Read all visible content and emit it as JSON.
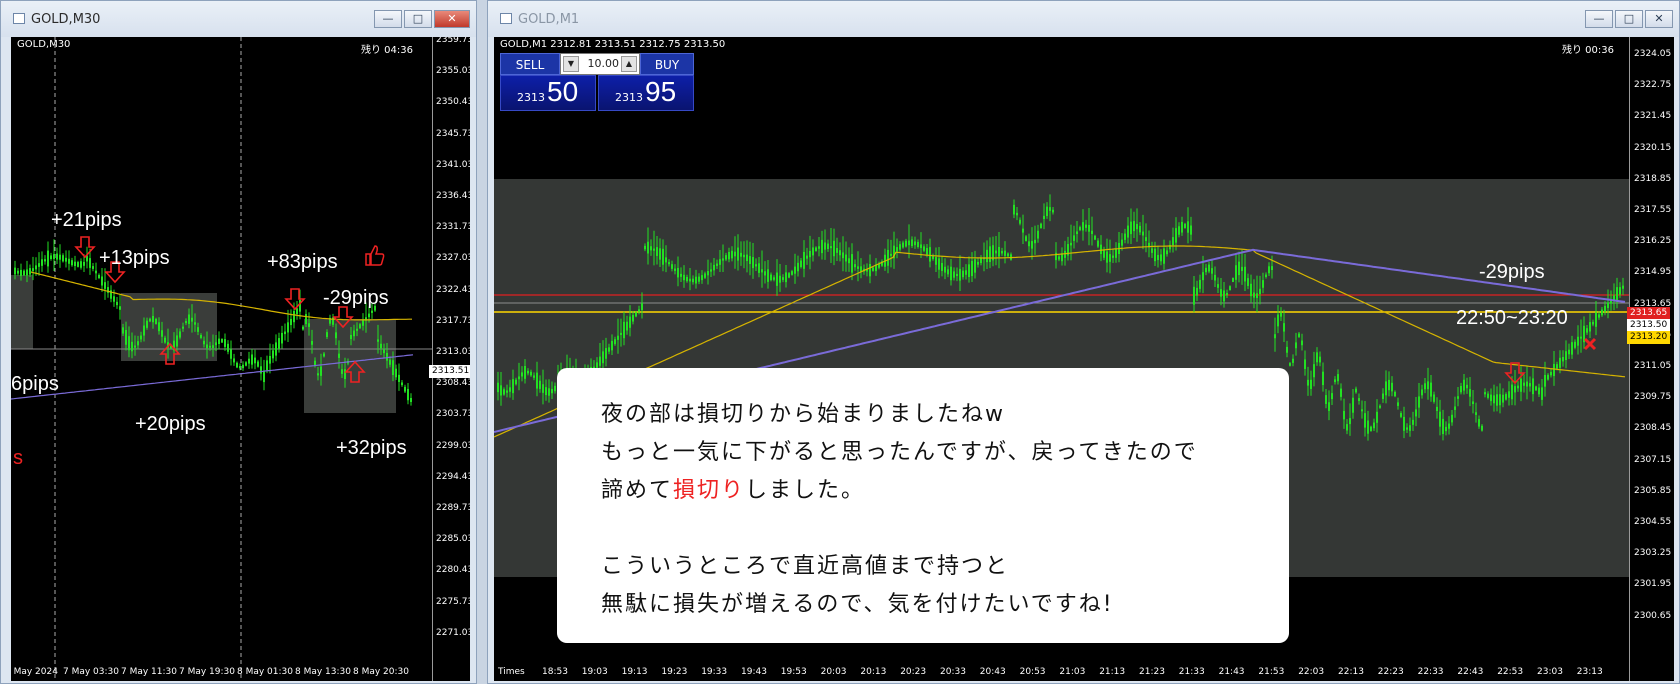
{
  "left_window": {
    "title": "GOLD,M30",
    "chart_label": "GOLD,M30",
    "remaining": "残り 04:36",
    "price_ticks": [
      "2359.73",
      "2355.03",
      "2350.43",
      "2345.73",
      "2341.03",
      "2336.43",
      "2331.73",
      "2327.03",
      "2322.43",
      "2317.73",
      "2313.03",
      "2308.43",
      "2303.73",
      "2299.03",
      "2294.43",
      "2289.73",
      "2285.03",
      "2280.43",
      "2275.73",
      "2271.03"
    ],
    "current_price": "2313.51",
    "time_ticks": [
      "6 May 2024",
      "7 May 03:30",
      "7 May 11:30",
      "7 May 19:30",
      "8 May 01:30",
      "8 May 13:30",
      "8 May 20:30"
    ],
    "annotations": [
      "+21pips",
      "+13pips",
      "+83pips",
      "-29pips",
      "6pips",
      "+20pips",
      "+32pips",
      "s"
    ]
  },
  "right_window": {
    "title": "GOLD,M1",
    "chart_label": "GOLD,M1  2312.81 2313.51 2312.75 2313.50",
    "remaining": "残り 00:36",
    "sell_label": "SELL",
    "buy_label": "BUY",
    "lot_value": "10.00",
    "bid_small": "2313",
    "bid_large": "50",
    "ask_small": "2313",
    "ask_large": "95",
    "price_ticks": [
      "2324.05",
      "2322.75",
      "2321.45",
      "2320.15",
      "2318.85",
      "2317.55",
      "2316.25",
      "2314.95",
      "2313.65",
      "2312.35",
      "2311.05",
      "2309.75",
      "2308.45",
      "2307.15",
      "2305.85",
      "2304.55",
      "2303.25",
      "2301.95",
      "2300.65"
    ],
    "price_tags": {
      "red": "2313.65",
      "current": "2313.50",
      "yellow": "2313.20"
    },
    "time_ticks": [
      "18:53",
      "19:03",
      "19:13",
      "19:23",
      "19:33",
      "19:43",
      "19:53",
      "20:03",
      "20:13",
      "20:23",
      "20:33",
      "20:43",
      "20:53",
      "21:03",
      "21:13",
      "21:23",
      "21:33",
      "21:43",
      "21:53",
      "22:03",
      "22:13",
      "22:23",
      "22:33",
      "22:43",
      "22:53",
      "23:03",
      "23:13"
    ],
    "time_corner": "Times",
    "annotations": {
      "pips": "-29pips",
      "range": "22:50~23:20"
    },
    "textbox": {
      "line1": "夜の部は損切りから始まりましたねw",
      "line2": "もっと一気に下がると思ったんですが、戻ってきたので",
      "line3_a": "諦めて",
      "line3_red": "損切り",
      "line3_b": "しました。",
      "line4": "こういうところで直近高値まで持つと",
      "line5": "無駄に損失が増えるので、気を付けたいですね!"
    }
  },
  "colors": {
    "candle": "#22e122",
    "ma_yellow": "#d6b400",
    "ma_purple": "#7a6bd8",
    "red_line": "#e02020",
    "yellow_line": "#ffd700"
  }
}
